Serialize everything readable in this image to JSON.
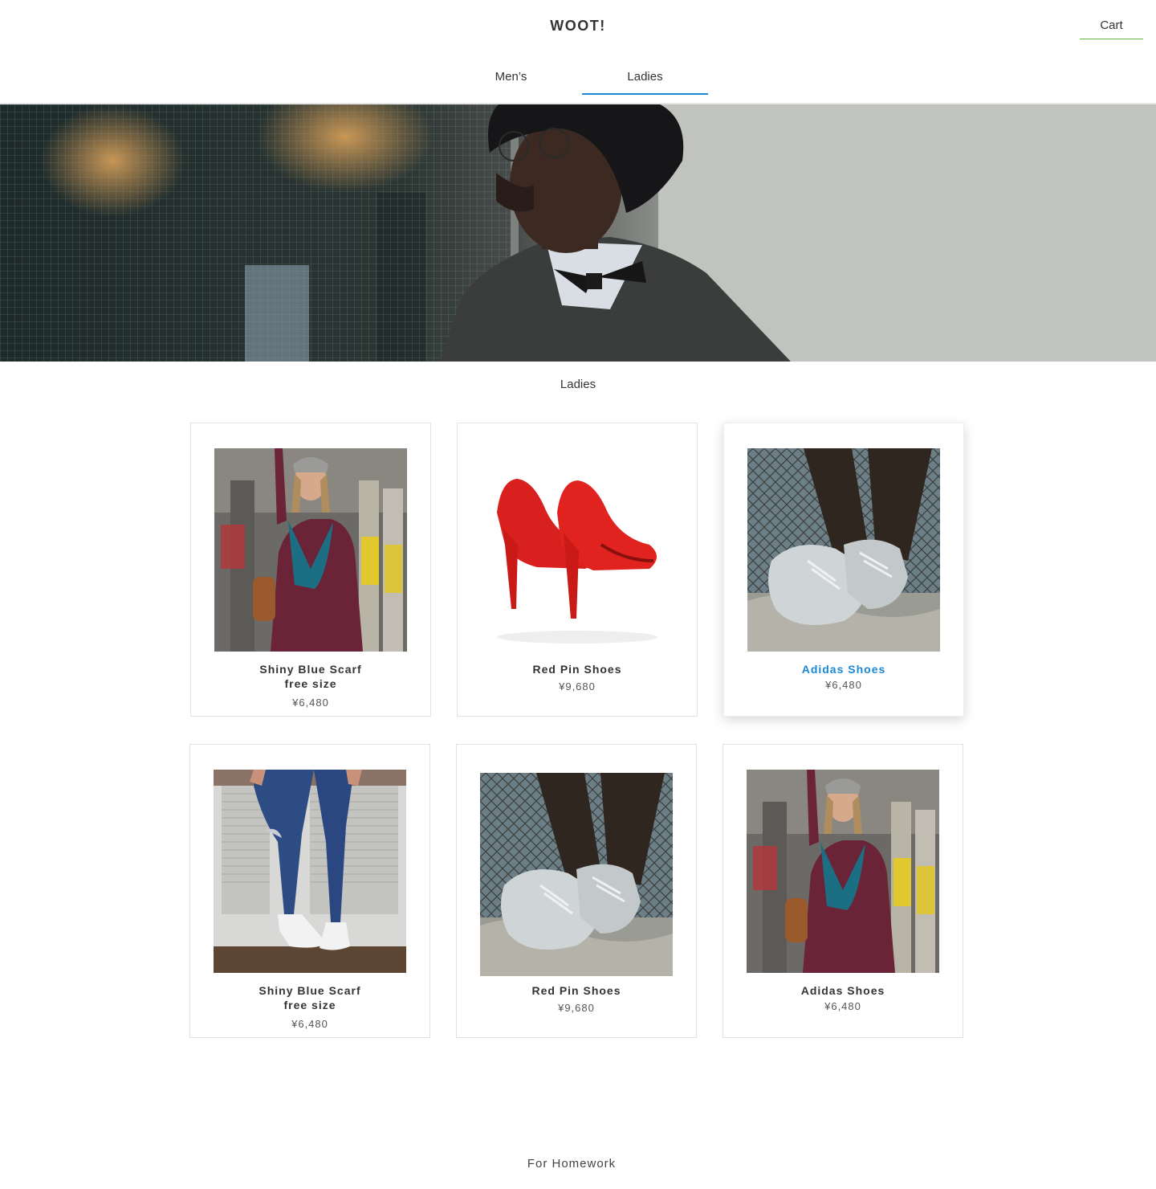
{
  "header": {
    "logo": "WOOT!",
    "cart_label": "Cart"
  },
  "nav": {
    "tabs": [
      {
        "label": "Men’s",
        "active": false
      },
      {
        "label": "Ladies",
        "active": true
      }
    ]
  },
  "main": {
    "section_title": "Ladies",
    "products": [
      {
        "name": "Shiny Blue Scarf",
        "size": "free size",
        "price": "¥6,480",
        "image": "woman-blue-scarf"
      },
      {
        "name": "Red Pin Shoes",
        "size": "",
        "price": "¥9,680",
        "image": "red-high-heels"
      },
      {
        "name": "Adidas Shoes",
        "size": "",
        "price": "¥6,480",
        "image": "grey-sneakers",
        "hovered": true
      },
      {
        "name": "Shiny Blue Scarf",
        "size": "free size",
        "price": "¥6,480",
        "image": "jeans-white-sneakers"
      },
      {
        "name": "Red Pin Shoes",
        "size": "",
        "price": "¥9,680",
        "image": "grey-sneakers"
      },
      {
        "name": "Adidas Shoes",
        "size": "",
        "price": "¥6,480",
        "image": "woman-blue-scarf"
      }
    ]
  },
  "footer": {
    "text": "For Homework"
  },
  "colors": {
    "accent_blue": "#1a88d3",
    "cart_underline": "#5fb839"
  }
}
